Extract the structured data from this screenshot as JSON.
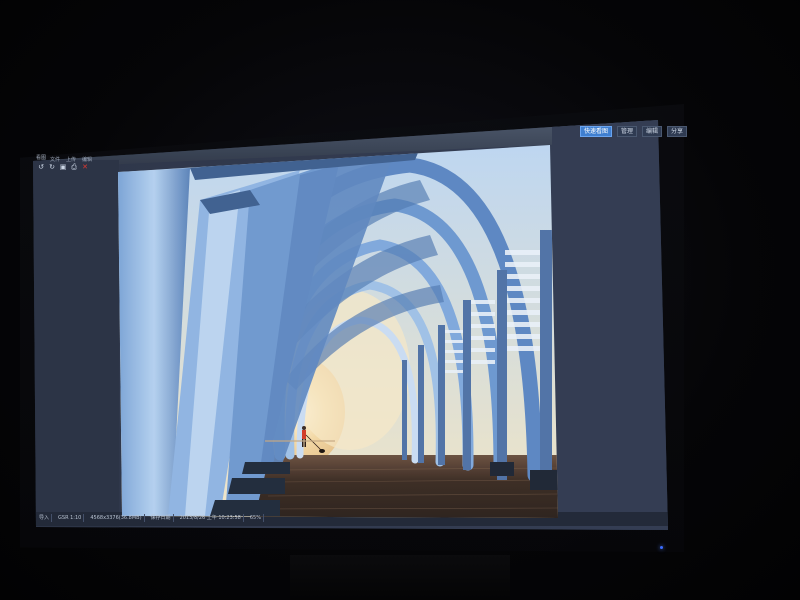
{
  "app": {
    "title": "看图",
    "menu": [
      "文件",
      "上传",
      "编辑"
    ],
    "top_buttons": [
      {
        "label": "快速看图",
        "active": true
      },
      {
        "label": "管理",
        "active": false
      },
      {
        "label": "编辑",
        "active": false
      },
      {
        "label": "分享",
        "active": false
      }
    ],
    "toolbar_icons": [
      {
        "name": "rotate-left-icon",
        "glyph": "↺"
      },
      {
        "name": "rotate-right-icon",
        "glyph": "↻"
      },
      {
        "name": "save-icon",
        "glyph": "▣"
      },
      {
        "name": "print-icon",
        "glyph": "⎙"
      },
      {
        "name": "delete-icon",
        "glyph": "✕"
      }
    ],
    "status_items": [
      "导入",
      "GSR 1:10",
      "4568x3376(36.8MB)",
      "保存日期",
      "2013/8/26 上午 10:23:58",
      "65%"
    ]
  },
  "colors": {
    "sky": "#f3e4c0",
    "arch_blue": "#6f9cd6",
    "arch_light": "#cfe2f6",
    "deck": "#3a2c22",
    "side_panel": "#2b3447",
    "accent": "#3f7fd0",
    "figure_red": "#d23a26"
  }
}
